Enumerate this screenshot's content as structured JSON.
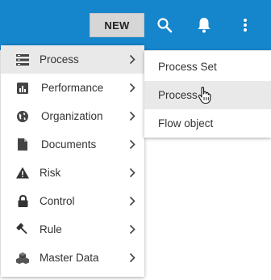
{
  "topbar": {
    "bg_color": "#1585cc",
    "new_label": "NEW",
    "icons": [
      "search-icon",
      "bell-icon",
      "more-vertical-icon"
    ]
  },
  "menu": {
    "items": [
      {
        "label": "Process",
        "icon": "process-list-icon",
        "active": true
      },
      {
        "label": "Performance",
        "icon": "bar-chart-icon"
      },
      {
        "label": "Organization",
        "icon": "globe-icon"
      },
      {
        "label": "Documents",
        "icon": "document-icon"
      },
      {
        "label": "Risk",
        "icon": "warning-icon"
      },
      {
        "label": "Control",
        "icon": "lock-icon"
      },
      {
        "label": "Rule",
        "icon": "gavel-icon"
      },
      {
        "label": "Master Data",
        "icon": "cubes-icon"
      }
    ]
  },
  "submenu": {
    "items": [
      {
        "label": "Process Set"
      },
      {
        "label": "Process",
        "hovered": true
      },
      {
        "label": "Flow object"
      }
    ]
  }
}
